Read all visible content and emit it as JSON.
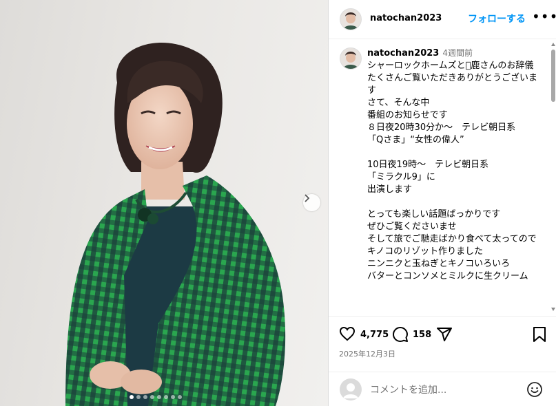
{
  "post": {
    "username": "natochan2023",
    "follow_label": "フォローする",
    "more_label": "•••",
    "caption_username": "natochan2023",
    "time_ago": "4週間前",
    "caption": "シャーロックホームズと\u0000鹿さんのお辞儀\nたくさんご覧いただきありがとうございます\nさて、そんな中\n番組のお知らせです\n８日夜20時30分か〜　テレビ朝日系\n「Qさま」“女性の偉人”\n\n10日夜19時〜　テレビ朝日系\n「ミラクル9」に\n出演します\n\nとっても楽しい話題ばっかりです\nぜひご覧くださいませ\nそして旅でご馳走ばかり食べて太ってので\nキノコのリゾット作りました\nニンニクと玉ねぎとキノコいろいろ\nバターとコンソメとミルクに生クリーム",
    "likes": "4,775",
    "comments": "158",
    "date": "2025年12月3日",
    "comment_placeholder": "コメントを追加...",
    "carousel_total": 8,
    "carousel_current": 1
  },
  "icons": {
    "like": "heart-icon",
    "comment": "comment-bubble-icon",
    "share": "paper-plane-icon",
    "save": "bookmark-icon",
    "emoji": "smiley-icon",
    "next": "chevron-right-icon"
  },
  "colors": {
    "link": "#0095f6",
    "muted": "#737373",
    "jacket_green": "#1f9a45",
    "jacket_navy": "#1a2a3a"
  }
}
